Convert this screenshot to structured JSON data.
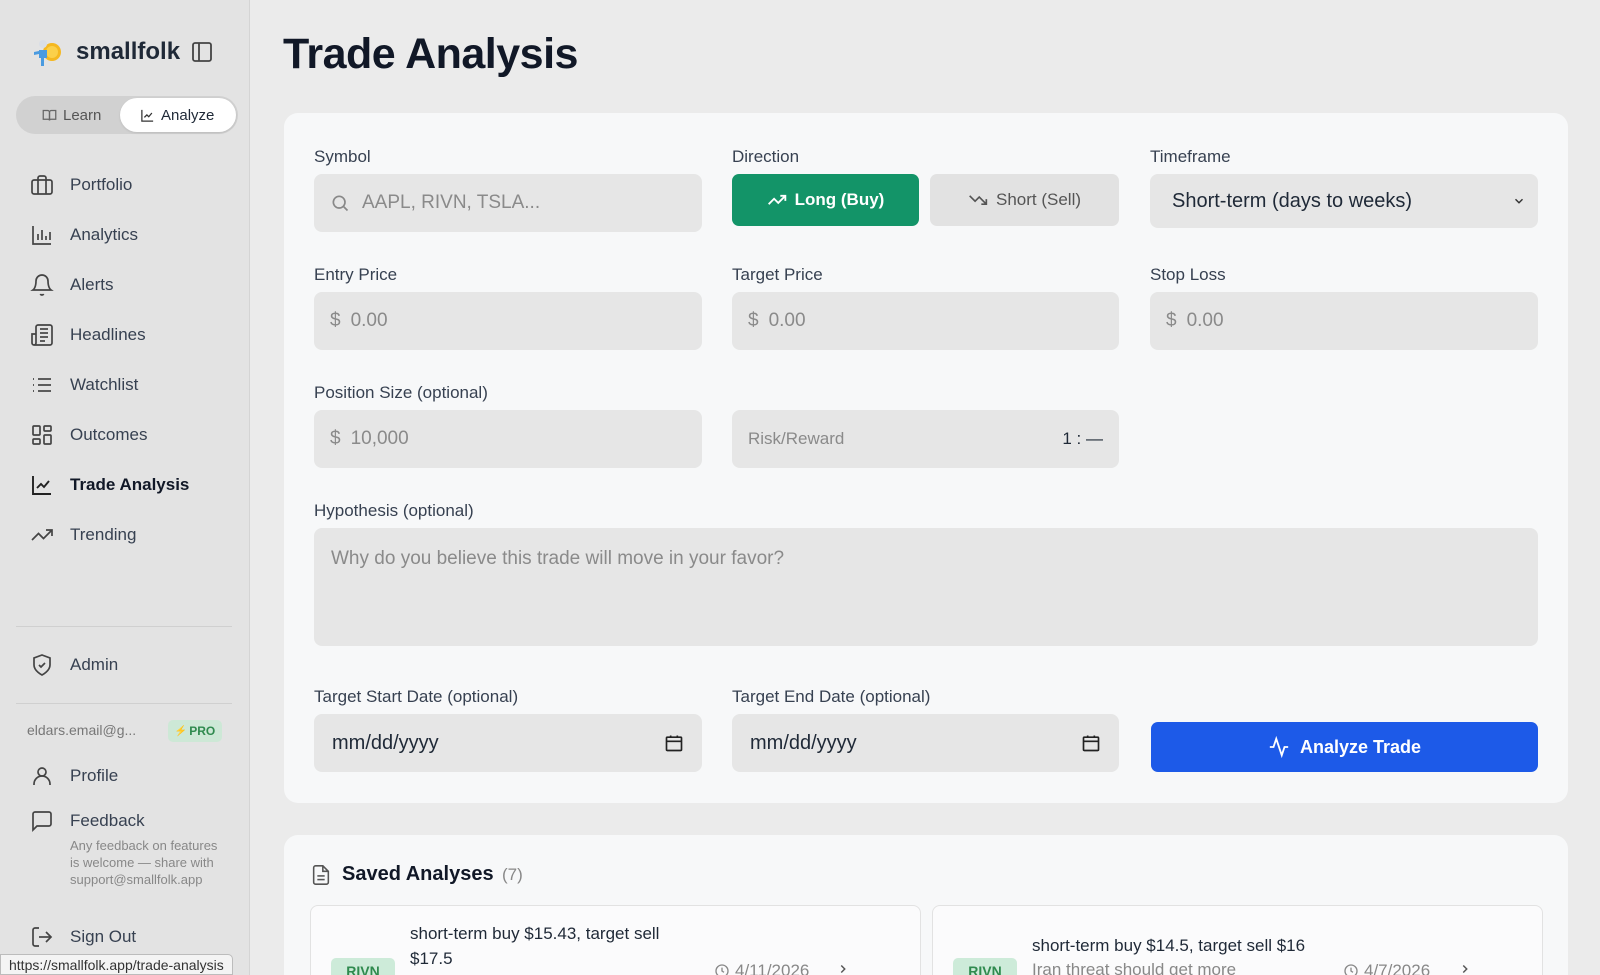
{
  "app": {
    "name": "smallfolk"
  },
  "mode_switch": {
    "learn": "Learn",
    "analyze": "Analyze"
  },
  "nav": [
    {
      "label": "Portfolio",
      "icon": "briefcase-icon"
    },
    {
      "label": "Analytics",
      "icon": "bar-chart-icon"
    },
    {
      "label": "Alerts",
      "icon": "bell-icon"
    },
    {
      "label": "Headlines",
      "icon": "newspaper-icon"
    },
    {
      "label": "Watchlist",
      "icon": "list-icon"
    },
    {
      "label": "Outcomes",
      "icon": "grid-icon"
    },
    {
      "label": "Trade Analysis",
      "icon": "line-chart-icon",
      "active": true
    },
    {
      "label": "Trending",
      "icon": "trending-up-icon"
    }
  ],
  "admin": {
    "label": "Admin"
  },
  "user": {
    "email": "eldars.email@g...",
    "badge": "PRO"
  },
  "profile": {
    "label": "Profile"
  },
  "feedback": {
    "label": "Feedback",
    "note": "Any feedback on features is welcome — share with support@smallfolk.app"
  },
  "signout": {
    "label": "Sign Out"
  },
  "status_url": "https://smallfolk.app/trade-analysis",
  "page": {
    "title": "Trade Analysis"
  },
  "form": {
    "symbol": {
      "label": "Symbol",
      "placeholder": "AAPL, RIVN, TSLA..."
    },
    "direction": {
      "label": "Direction",
      "long": "Long (Buy)",
      "short": "Short (Sell)"
    },
    "timeframe": {
      "label": "Timeframe",
      "value": "Short-term (days to weeks)"
    },
    "entry_price": {
      "label": "Entry Price",
      "prefix": "$",
      "placeholder": "0.00"
    },
    "target_price": {
      "label": "Target Price",
      "prefix": "$",
      "placeholder": "0.00"
    },
    "stop_loss": {
      "label": "Stop Loss",
      "prefix": "$",
      "placeholder": "0.00"
    },
    "position_size": {
      "label": "Position Size (optional)",
      "prefix": "$",
      "placeholder": "10,000"
    },
    "risk_reward": {
      "label": "Risk/Reward",
      "value": "1 : —"
    },
    "hypothesis": {
      "label": "Hypothesis (optional)",
      "placeholder": "Why do you believe this trade will move in your favor?"
    },
    "start_date": {
      "label": "Target Start Date (optional)",
      "placeholder": "mm/dd/yyyy"
    },
    "end_date": {
      "label": "Target End Date (optional)",
      "placeholder": "mm/dd/yyyy"
    },
    "analyze_button": "Analyze Trade"
  },
  "saved": {
    "title": "Saved Analyses",
    "count": "(7)",
    "items": [
      {
        "symbol": "RIVN",
        "title_line1": "short-term buy $15.43, target sell",
        "title_line2": "$17.5",
        "date": "4/11/2026"
      },
      {
        "symbol": "RIVN",
        "title_line1": "short-term buy $14.5, target sell $16",
        "subtitle": "Iran threat should get more",
        "date": "4/7/2026"
      }
    ]
  },
  "colors": {
    "long": "#139468",
    "analyze": "#1d5ae8",
    "pro": "#2f8a4e"
  }
}
